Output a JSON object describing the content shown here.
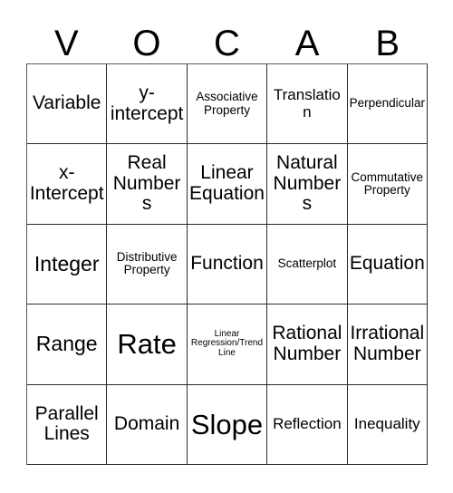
{
  "card": {
    "title": "Vocab Bingo Card",
    "header_letters": [
      "V",
      "O",
      "C",
      "A",
      "B"
    ],
    "rows": [
      [
        {
          "label": "Variable",
          "size": "lg"
        },
        {
          "label": "y-\nintercept",
          "size": "lg"
        },
        {
          "label": "Associative\nProperty",
          "size": "sm"
        },
        {
          "label": "Translation",
          "size": "md"
        },
        {
          "label": "Perpendicular",
          "size": "sm"
        }
      ],
      [
        {
          "label": "x-\nIntercept",
          "size": "lg"
        },
        {
          "label": "Real\nNumbers",
          "size": "lg"
        },
        {
          "label": "Linear\nEquation",
          "size": "lg"
        },
        {
          "label": "Natural\nNumbers",
          "size": "lg"
        },
        {
          "label": "Commutative\nProperty",
          "size": "sm"
        }
      ],
      [
        {
          "label": "Integer",
          "size": "xl"
        },
        {
          "label": "Distributive\nProperty",
          "size": "sm"
        },
        {
          "label": "Function",
          "size": "lg"
        },
        {
          "label": "Scatterplot",
          "size": "sm"
        },
        {
          "label": "Equation",
          "size": "lg"
        }
      ],
      [
        {
          "label": "Range",
          "size": "xl"
        },
        {
          "label": "Rate",
          "size": "xxl"
        },
        {
          "label": "Linear\nRegression/Trend\nLine",
          "size": "xs"
        },
        {
          "label": "Rational\nNumber",
          "size": "lg"
        },
        {
          "label": "Irrational\nNumber",
          "size": "lg"
        }
      ],
      [
        {
          "label": "Parallel\nLines",
          "size": "lg"
        },
        {
          "label": "Domain",
          "size": "lg"
        },
        {
          "label": "Slope",
          "size": "xxl"
        },
        {
          "label": "Reflection",
          "size": "md"
        },
        {
          "label": "Inequality",
          "size": "md"
        }
      ]
    ]
  },
  "colors": {
    "page_background": "#ffffff",
    "cell_background": "#ffffff",
    "grid_line": "#2b2b2b",
    "text": "#000000"
  }
}
